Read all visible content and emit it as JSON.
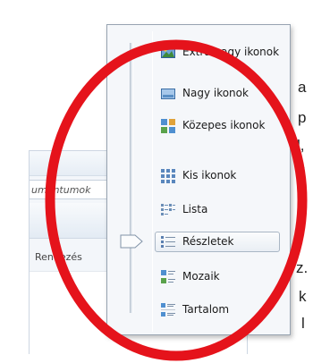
{
  "page_text": {
    "fragments": [
      "a",
      "p",
      "l,",
      "t",
      "z.",
      "k",
      "l"
    ]
  },
  "explorer": {
    "address_fragment": "umentumok",
    "organize_label": "Rendezés"
  },
  "views_menu": {
    "items": [
      {
        "label": "Extra nagy ikonok",
        "icon": "extra-large-icons-icon"
      },
      {
        "label": "Nagy ikonok",
        "icon": "large-icons-icon"
      },
      {
        "label": "Közepes ikonok",
        "icon": "medium-icons-icon"
      },
      {
        "label": "Kis ikonok",
        "icon": "small-icons-icon"
      },
      {
        "label": "Lista",
        "icon": "list-icon"
      },
      {
        "label": "Részletek",
        "icon": "details-icon",
        "selected": true
      },
      {
        "label": "Mozaik",
        "icon": "tiles-icon"
      },
      {
        "label": "Tartalom",
        "icon": "content-icon"
      }
    ]
  },
  "annotation": {
    "color": "#e5131b"
  }
}
